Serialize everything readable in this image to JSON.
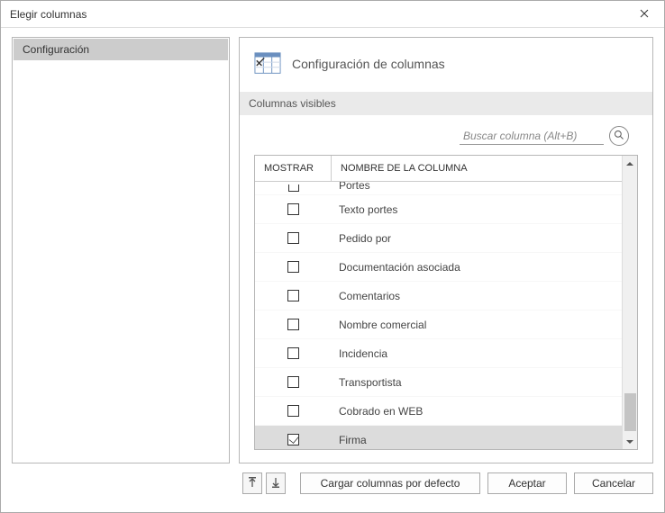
{
  "window": {
    "title": "Elegir columnas"
  },
  "sidebar": {
    "items": [
      {
        "label": "Configuración"
      }
    ]
  },
  "main": {
    "section_title": "Configuración de columnas",
    "sub_header": "Columnas visibles",
    "search_placeholder": "Buscar columna (Alt+B)",
    "search_value": "",
    "table": {
      "header_show": "MOSTRAR",
      "header_name": "NOMBRE DE LA COLUMNA",
      "rows": [
        {
          "checked": false,
          "name": "Portes",
          "partial": true
        },
        {
          "checked": false,
          "name": "Texto portes"
        },
        {
          "checked": false,
          "name": "Pedido por"
        },
        {
          "checked": false,
          "name": "Documentación asociada"
        },
        {
          "checked": false,
          "name": "Comentarios"
        },
        {
          "checked": false,
          "name": "Nombre comercial"
        },
        {
          "checked": false,
          "name": "Incidencia"
        },
        {
          "checked": false,
          "name": "Transportista"
        },
        {
          "checked": false,
          "name": "Cobrado en WEB"
        },
        {
          "checked": true,
          "name": "Firma",
          "selected": true
        }
      ]
    }
  },
  "footer": {
    "load_defaults": "Cargar columnas por defecto",
    "accept": "Aceptar",
    "cancel": "Cancelar"
  }
}
